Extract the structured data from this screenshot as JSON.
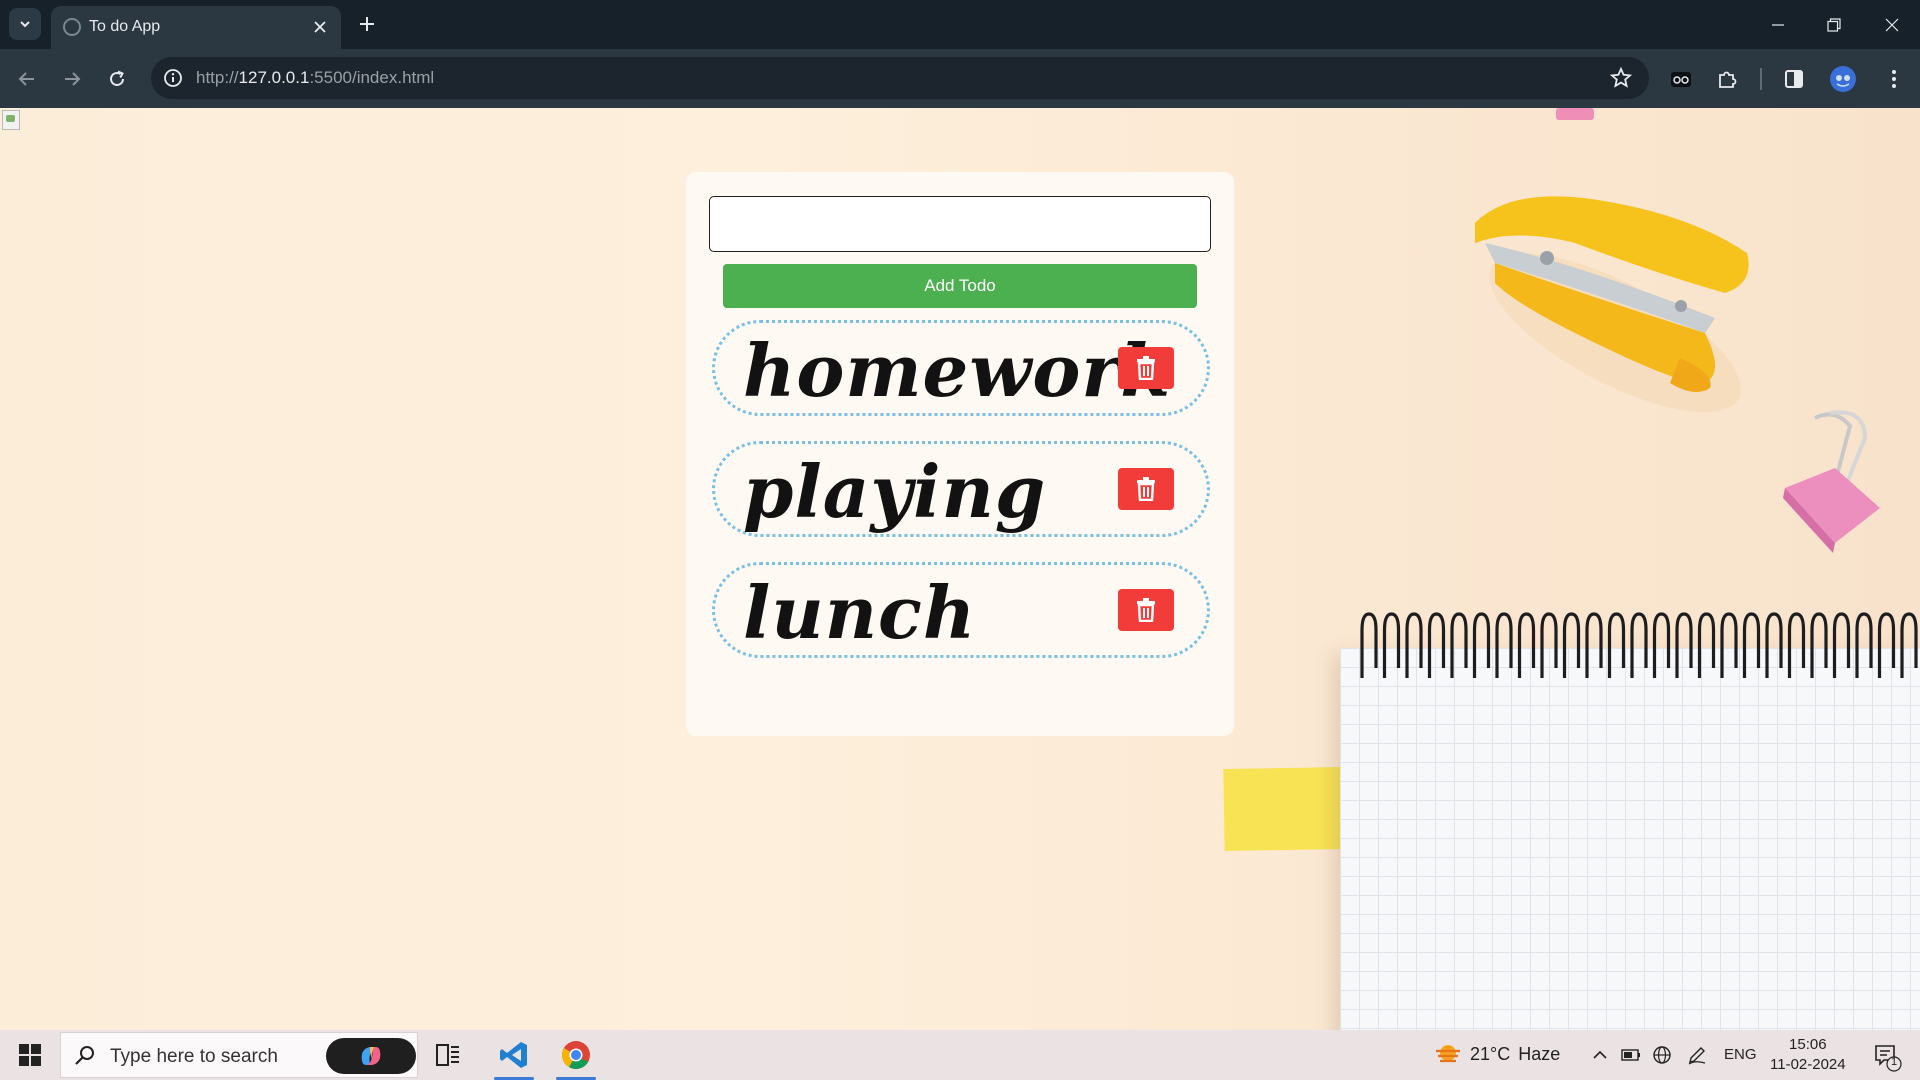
{
  "browser": {
    "tab_title": "To do App",
    "url_prefix": "http://",
    "url_host": "127.0.0.1",
    "url_rest": ":5500/index.html"
  },
  "app": {
    "input_value": "",
    "add_button_label": "Add Todo",
    "todos": [
      {
        "text": "homework"
      },
      {
        "text": "playing"
      },
      {
        "text": "lunch"
      }
    ],
    "colors": {
      "add_button": "#4caf50",
      "delete_button": "#f13c3a",
      "item_border": "#79bfe3",
      "card_background": "#fef9f3"
    }
  },
  "taskbar": {
    "search_placeholder": "Type here to search",
    "weather": {
      "temperature": "21°C",
      "condition": "Haze"
    },
    "language": "ENG",
    "time": "15:06",
    "date": "11-02-2024",
    "notification_count": "1"
  }
}
